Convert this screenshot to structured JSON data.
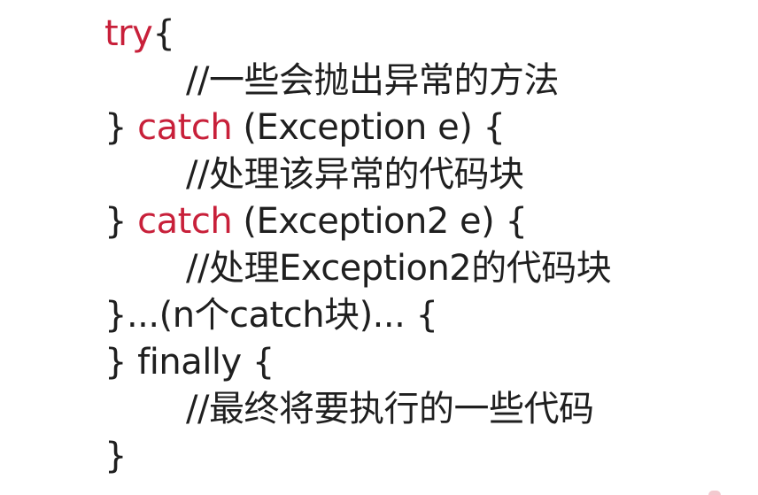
{
  "code": {
    "line1": {
      "kw": "try",
      "rest": "{"
    },
    "line2": {
      "text": "//一些会抛出异常的方法"
    },
    "line3": {
      "pre": "} ",
      "kw": "catch",
      "rest": " (Exception e) {"
    },
    "line4": {
      "text": "//处理该异常的代码块"
    },
    "line5": {
      "pre": "} ",
      "kw": "catch",
      "rest": " (Exception2 e) {"
    },
    "line6": {
      "text": "//处理Exception2的代码块"
    },
    "line7": {
      "text": "}...(n个catch块)... {"
    },
    "line8": {
      "text": "} finally {"
    },
    "line9": {
      "text": "//最终将要执行的一些代码"
    },
    "line10": {
      "text": "}"
    }
  },
  "colors": {
    "keyword": "#c8203a",
    "text": "#1f1f1f",
    "background": "#ffffff"
  }
}
